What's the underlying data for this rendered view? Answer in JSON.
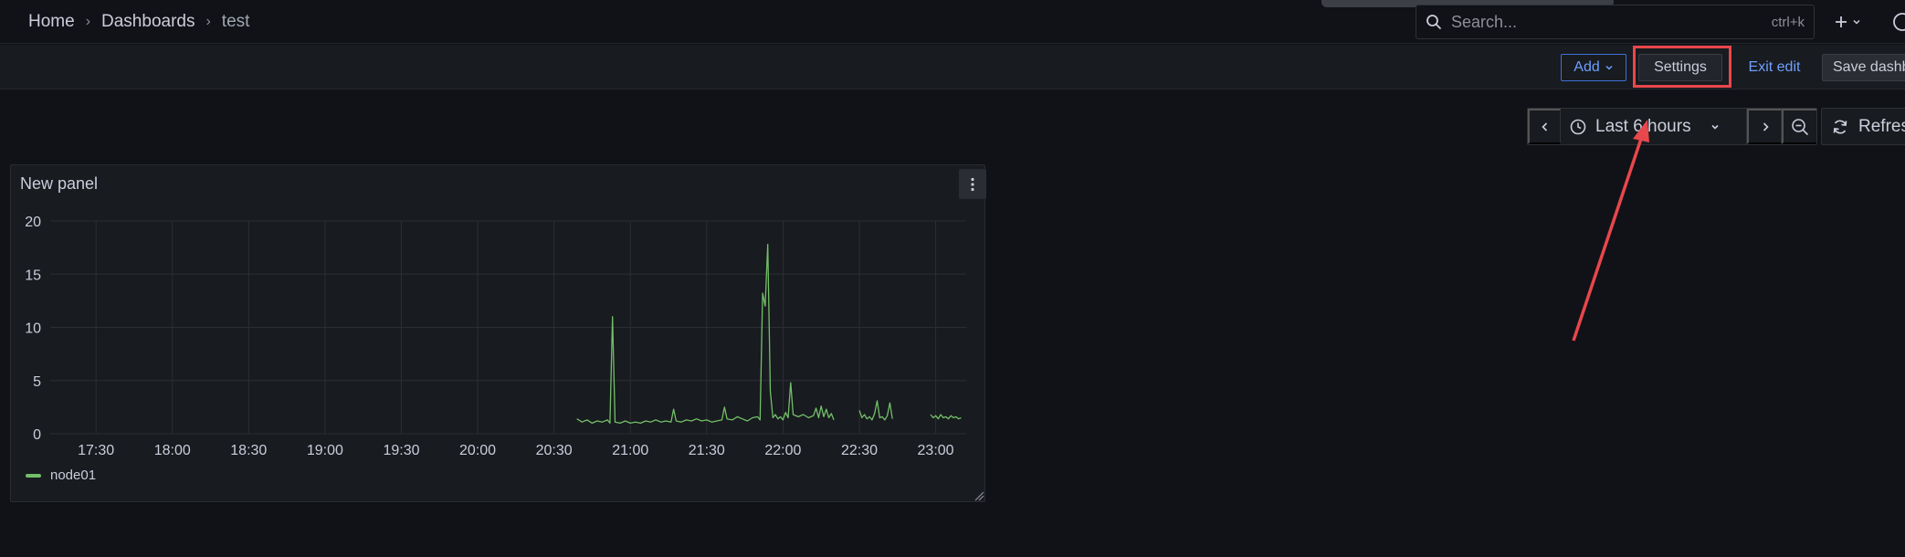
{
  "breadcrumb": {
    "home": "Home",
    "dashboards": "Dashboards",
    "current": "test"
  },
  "search": {
    "placeholder": "Search...",
    "shortcut": "ctrl+k"
  },
  "toolbar": {
    "add_label": "Add",
    "settings_label": "Settings",
    "exit_edit_label": "Exit edit",
    "save_label": "Save dashb"
  },
  "time_picker": {
    "range_label": "Last 6 hours",
    "refresh_label": "Refresh"
  },
  "panel": {
    "title": "New panel"
  },
  "colors": {
    "series": "#73bf69",
    "link": "#6e9fff",
    "highlight": "#e8474c"
  },
  "chart_data": {
    "type": "line",
    "title": "New panel",
    "xlabel": "",
    "ylabel": "",
    "ylim": [
      0,
      20
    ],
    "xlim": [
      "17:12",
      "23:12"
    ],
    "yticks": [
      0,
      5,
      10,
      15,
      20
    ],
    "xticks": [
      "17:30",
      "18:00",
      "18:30",
      "19:00",
      "19:30",
      "20:00",
      "20:30",
      "21:00",
      "21:30",
      "22:00",
      "22:30",
      "23:00"
    ],
    "grid": true,
    "legend": "bottom-left",
    "series": [
      {
        "name": "node01",
        "segments": [
          [
            [
              "20:39",
              1.4
            ],
            [
              "20:41",
              1.1
            ],
            [
              "20:43",
              1.3
            ],
            [
              "20:45",
              1.0
            ],
            [
              "20:47",
              1.2
            ],
            [
              "20:49",
              1.1
            ],
            [
              "20:51",
              1.3
            ],
            [
              "20:52",
              1.0
            ],
            [
              "20:53",
              11.0
            ],
            [
              "20:54",
              1.1
            ],
            [
              "20:56",
              1.0
            ],
            [
              "20:58",
              1.2
            ],
            [
              "21:00",
              1.0
            ],
            [
              "21:02",
              1.1
            ],
            [
              "21:04",
              1.0
            ],
            [
              "21:06",
              1.2
            ],
            [
              "21:08",
              1.1
            ],
            [
              "21:10",
              1.3
            ],
            [
              "21:12",
              1.1
            ],
            [
              "21:14",
              1.2
            ],
            [
              "21:16",
              1.1
            ],
            [
              "21:17",
              2.3
            ],
            [
              "21:18",
              1.2
            ],
            [
              "21:20",
              1.1
            ],
            [
              "21:22",
              1.3
            ],
            [
              "21:24",
              1.2
            ],
            [
              "21:26",
              1.4
            ],
            [
              "21:28",
              1.2
            ],
            [
              "21:30",
              1.3
            ],
            [
              "21:32",
              1.1
            ],
            [
              "21:34",
              1.2
            ],
            [
              "21:36",
              1.3
            ],
            [
              "21:37",
              2.5
            ],
            [
              "21:38",
              1.4
            ],
            [
              "21:40",
              1.3
            ],
            [
              "21:42",
              1.6
            ],
            [
              "21:44",
              1.4
            ],
            [
              "21:46",
              1.2
            ],
            [
              "21:48",
              1.5
            ],
            [
              "21:50",
              1.6
            ],
            [
              "21:51",
              1.3
            ],
            [
              "21:52",
              13.2
            ],
            [
              "21:53",
              12.0
            ],
            [
              "21:54",
              17.8
            ],
            [
              "21:55",
              4.0
            ],
            [
              "21:56",
              1.5
            ],
            [
              "21:57",
              1.8
            ],
            [
              "21:58",
              1.4
            ],
            [
              "21:59",
              1.6
            ],
            [
              "22:00",
              1.3
            ],
            [
              "22:01",
              2.0
            ],
            [
              "22:02",
              1.5
            ],
            [
              "22:03",
              4.8
            ],
            [
              "22:04",
              1.8
            ],
            [
              "22:06",
              1.6
            ],
            [
              "22:08",
              1.8
            ],
            [
              "22:10",
              1.5
            ],
            [
              "22:12",
              1.7
            ],
            [
              "22:13",
              2.4
            ],
            [
              "22:14",
              1.5
            ],
            [
              "22:15",
              2.6
            ],
            [
              "22:16",
              1.6
            ],
            [
              "22:17",
              2.3
            ],
            [
              "22:18",
              1.5
            ],
            [
              "22:19",
              1.9
            ],
            [
              "22:20",
              1.3
            ]
          ],
          [
            [
              "22:30",
              2.2
            ],
            [
              "22:31",
              1.5
            ],
            [
              "22:32",
              1.8
            ],
            [
              "22:33",
              1.4
            ],
            [
              "22:34",
              1.6
            ],
            [
              "22:35",
              1.3
            ],
            [
              "22:36",
              1.9
            ],
            [
              "22:37",
              3.1
            ],
            [
              "22:38",
              1.5
            ],
            [
              "22:39",
              1.6
            ],
            [
              "22:40",
              1.3
            ],
            [
              "22:41",
              1.7
            ],
            [
              "22:42",
              2.9
            ],
            [
              "22:43",
              1.4
            ]
          ],
          [
            [
              "22:58",
              1.8
            ],
            [
              "22:59",
              1.5
            ],
            [
              "23:00",
              1.7
            ],
            [
              "23:01",
              1.4
            ],
            [
              "23:02",
              1.8
            ],
            [
              "23:03",
              1.5
            ],
            [
              "23:04",
              1.6
            ],
            [
              "23:05",
              1.4
            ],
            [
              "23:06",
              1.7
            ],
            [
              "23:07",
              1.5
            ],
            [
              "23:08",
              1.6
            ],
            [
              "23:09",
              1.4
            ],
            [
              "23:10",
              1.5
            ]
          ]
        ]
      }
    ]
  }
}
